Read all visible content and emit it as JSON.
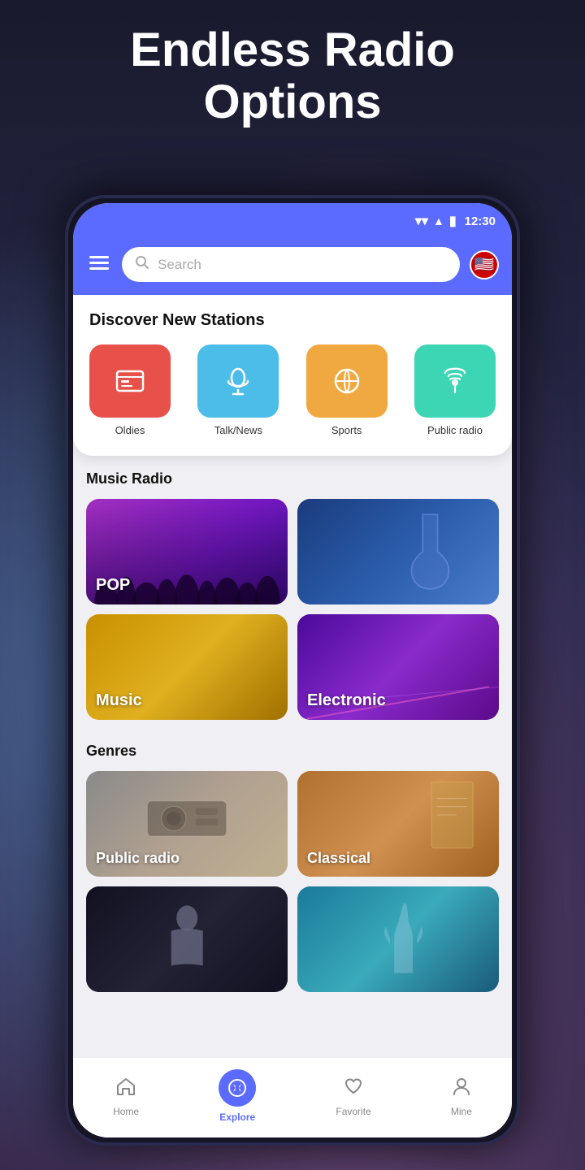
{
  "hero": {
    "title": "Endless Radio Options"
  },
  "status_bar": {
    "time": "12:30",
    "wifi": "▼",
    "signal": "▲",
    "battery": "🔋"
  },
  "header": {
    "menu_label": "☰",
    "search_placeholder": "Search",
    "flag_emoji": "🇺🇸"
  },
  "discover": {
    "title": "Discover New Stations",
    "categories": [
      {
        "id": "oldies",
        "label": "Oldies",
        "icon": "📅",
        "color_class": "cat-red"
      },
      {
        "id": "talk-news",
        "label": "Talk/News",
        "icon": "🎤",
        "color_class": "cat-blue"
      },
      {
        "id": "sports",
        "label": "Sports",
        "icon": "🏀",
        "color_class": "cat-orange"
      },
      {
        "id": "public-radio",
        "label": "Public radio",
        "icon": "📡",
        "color_class": "cat-teal"
      }
    ]
  },
  "music_radio": {
    "section_title": "Music Radio",
    "cards": [
      {
        "id": "pop",
        "label": "POP",
        "color_class": "pop-bg"
      },
      {
        "id": "guitar",
        "label": "",
        "color_class": "guitar-bg"
      },
      {
        "id": "music",
        "label": "Music",
        "color_class": "music-bg"
      },
      {
        "id": "electronic",
        "label": "Electronic",
        "color_class": "electronic-bg"
      }
    ]
  },
  "genres": {
    "section_title": "Genres",
    "cards": [
      {
        "id": "public-radio-genre",
        "label": "Public radio",
        "color_class": "public-radio-bg"
      },
      {
        "id": "classical",
        "label": "Classical",
        "color_class": "classical-bg"
      },
      {
        "id": "dark",
        "label": "",
        "color_class": "dark-bg"
      },
      {
        "id": "underwater",
        "label": "",
        "color_class": "underwater-bg"
      }
    ]
  },
  "bottom_nav": {
    "items": [
      {
        "id": "home",
        "label": "Home",
        "icon": "🏠",
        "active": false
      },
      {
        "id": "explore",
        "label": "Explore",
        "icon": "🧭",
        "active": true
      },
      {
        "id": "favorite",
        "label": "Favorite",
        "icon": "♡",
        "active": false
      },
      {
        "id": "mine",
        "label": "Mine",
        "icon": "👤",
        "active": false
      }
    ]
  }
}
